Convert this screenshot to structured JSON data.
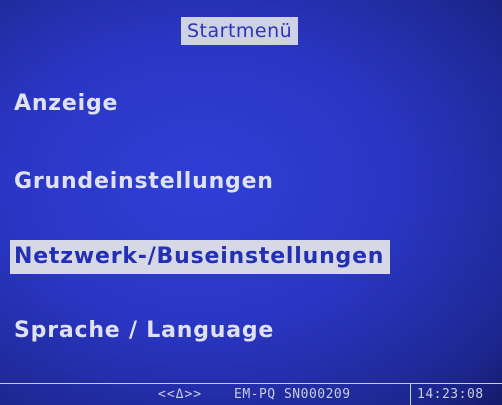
{
  "title": "Startmenü",
  "menu": {
    "items": [
      {
        "label": "Anzeige",
        "selected": false
      },
      {
        "label": "Grundeinstellungen",
        "selected": false
      },
      {
        "label": "Netzwerk-/Buseinstellungen",
        "selected": true
      },
      {
        "label": "Sprache / Language",
        "selected": false
      }
    ]
  },
  "status": {
    "symbol": "<<Δ>>",
    "device": "EM-PQ SN000209",
    "time": "14:23:08"
  },
  "colors": {
    "background": "#2a36c4",
    "text": "#dfe2ee",
    "highlight_bg": "#d6d8e6",
    "highlight_text": "#2330b4"
  }
}
